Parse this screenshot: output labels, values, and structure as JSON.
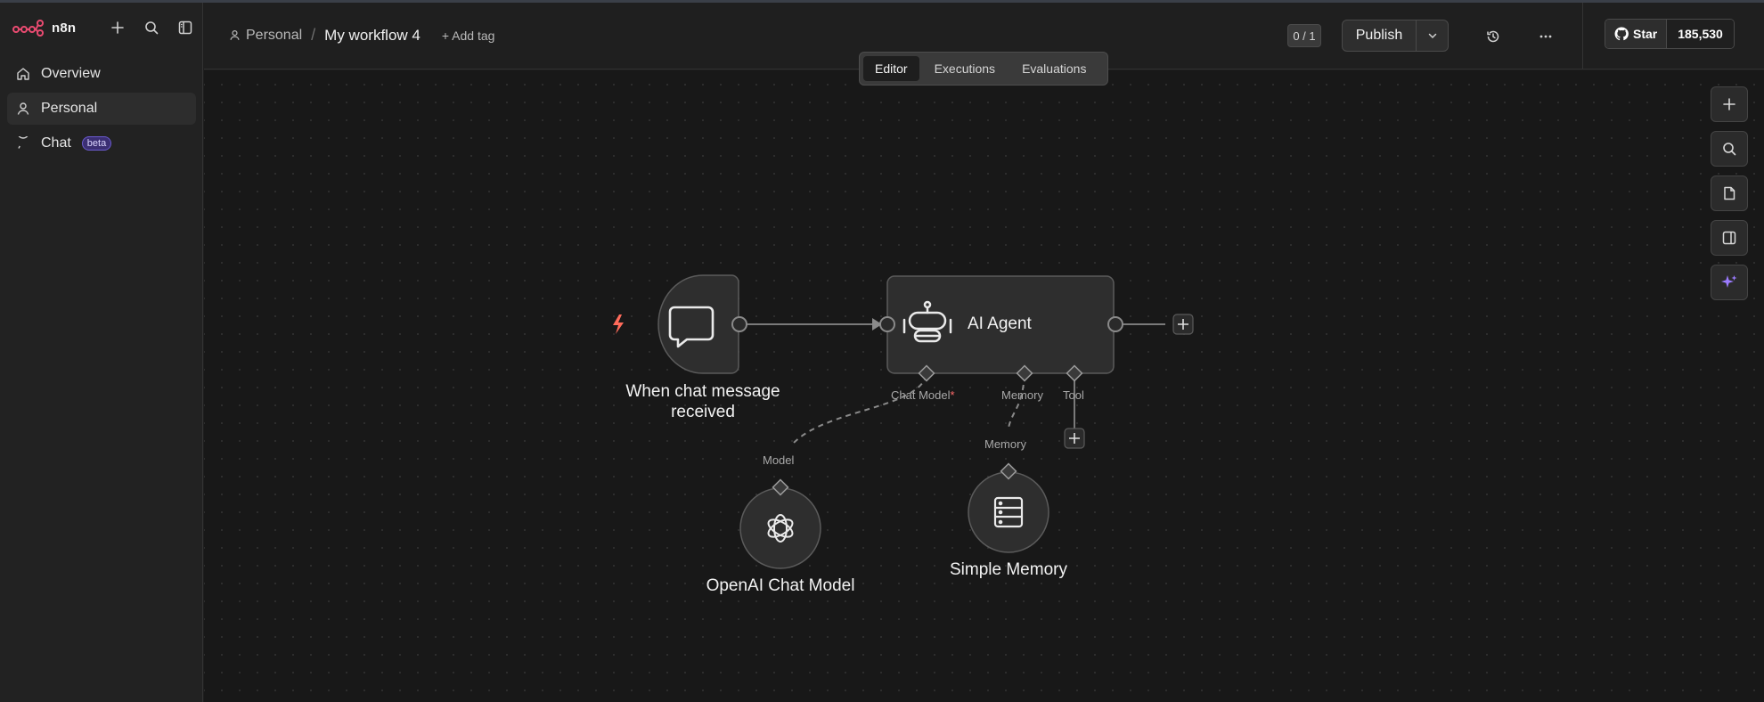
{
  "brand": {
    "name": "n8n",
    "logo_icon": "n8n-logo-icon"
  },
  "sidebar": {
    "actions": [
      {
        "name": "create-button",
        "icon": "plus-icon"
      },
      {
        "name": "search-button",
        "icon": "search-icon"
      },
      {
        "name": "toggle-sidebar-button",
        "icon": "panel-left-icon"
      }
    ],
    "items": [
      {
        "label": "Overview",
        "icon": "home-icon",
        "active": false
      },
      {
        "label": "Personal",
        "icon": "user-icon",
        "active": true
      },
      {
        "label": "Chat",
        "icon": "chat-bubble-icon",
        "badge": "beta",
        "active": false
      }
    ]
  },
  "header": {
    "breadcrumb_project": "Personal",
    "separator": "/",
    "workflow_name": "My workflow 4",
    "add_tag": "+ Add tag",
    "counter": "0 / 1",
    "publish_label": "Publish",
    "github_star_label": "Star",
    "github_star_count": "185,530"
  },
  "tabs": [
    {
      "label": "Editor",
      "active": true
    },
    {
      "label": "Executions",
      "active": false
    },
    {
      "label": "Evaluations",
      "active": false
    }
  ],
  "nodes": {
    "trigger": {
      "label_line1": "When chat message",
      "label_line2": "received",
      "icon": "chat-bubble-icon"
    },
    "agent": {
      "label": "AI Agent",
      "icon": "robot-icon"
    },
    "model": {
      "label": "OpenAI Chat Model",
      "icon": "openai-icon"
    },
    "memory": {
      "label": "Simple Memory",
      "icon": "database-icon"
    }
  },
  "ports": {
    "chat_model": "Chat Model",
    "chat_model_required": "*",
    "memory": "Memory",
    "tool": "Tool",
    "model_input": "Model",
    "memory_input": "Memory"
  },
  "right_tools": [
    {
      "name": "add-node-button",
      "icon": "plus-icon"
    },
    {
      "name": "search-nodes-button",
      "icon": "search-icon"
    },
    {
      "name": "sticky-note-button",
      "icon": "sticky-note-icon"
    },
    {
      "name": "toggle-panel-button",
      "icon": "panel-right-icon"
    },
    {
      "name": "ai-assistant-button",
      "icon": "sparkles-icon"
    }
  ],
  "colors": {
    "accent_purple": "#9b7bff",
    "trigger_bolt": "#ff6b5b",
    "logo": "#ea4b71"
  }
}
